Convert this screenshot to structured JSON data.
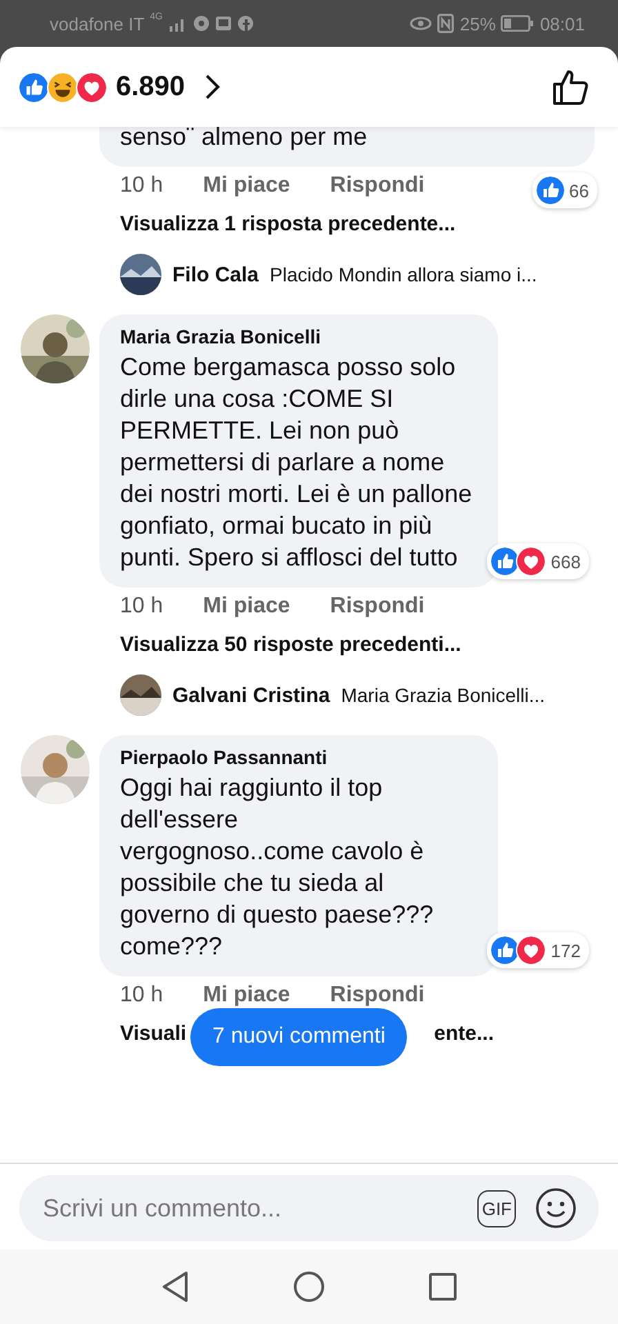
{
  "status_bar": {
    "carrier": "vodafone IT",
    "network": "4G",
    "battery": "25%",
    "time": "08:01"
  },
  "header": {
    "reactions": [
      {
        "kind": "like"
      },
      {
        "kind": "haha"
      },
      {
        "kind": "love"
      }
    ],
    "count": "6.890"
  },
  "comments": [
    {
      "text": "senso¨ almeno per me",
      "reactions": [
        {
          "kind": "like"
        }
      ],
      "reaction_count": "66",
      "time": "10 h",
      "like": "Mi piace",
      "reply": "Rispondi",
      "view_replies": "Visualizza 1 risposta precedente...",
      "reply_preview": {
        "author": "Filo Cala",
        "text": "Placido Mondin allora siamo i..."
      }
    },
    {
      "author": "Maria Grazia Bonicelli",
      "text": "Come bergamasca posso solo dirle una cosa :COME SI PERMETTE. Lei non può permettersi di parlare a nome dei nostri morti. Lei è un pallone gonfiato, ormai bucato in più punti. Spero si afflosci del tutto",
      "reactions": [
        {
          "kind": "like"
        },
        {
          "kind": "love"
        }
      ],
      "reaction_count": "668",
      "time": "10 h",
      "like": "Mi piace",
      "reply": "Rispondi",
      "view_replies": "Visualizza 50 risposte precedenti...",
      "reply_preview": {
        "author": "Galvani Cristina",
        "text": "Maria Grazia Bonicelli..."
      }
    },
    {
      "author": "Pierpaolo Passannanti",
      "text": "Oggi hai raggiunto il top\ndell'essere\nvergognoso..come cavolo è possibile che tu sieda al governo di questo paese??? come???",
      "reactions": [
        {
          "kind": "like"
        },
        {
          "kind": "love"
        }
      ],
      "reaction_count": "172",
      "time": "10 h",
      "like": "Mi piace",
      "reply": "Rispondi",
      "view_replies_parts": [
        "Visuali",
        "ente..."
      ]
    }
  ],
  "toast": "7 nuovi commenti",
  "composer": {
    "placeholder": "Scrivi un commento...",
    "gif": "GIF"
  }
}
